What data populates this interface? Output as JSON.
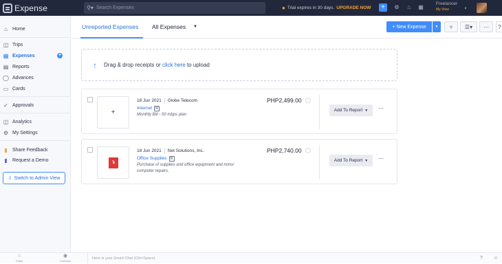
{
  "topbar": {
    "app_name": "Expense",
    "search_placeholder": "Search Expenses",
    "trial_text": "Trial expires in 30 days.",
    "upgrade_label": "UPGRADE NOW",
    "org_name": "Freelancer",
    "org_sub": "My View"
  },
  "sidebar": {
    "items": [
      {
        "label": "Home",
        "icon": "home-icon"
      },
      {
        "label": "Trips",
        "icon": "trips-icon"
      },
      {
        "label": "Expenses",
        "icon": "expenses-icon"
      },
      {
        "label": "Reports",
        "icon": "reports-icon"
      },
      {
        "label": "Advances",
        "icon": "advances-icon"
      },
      {
        "label": "Cards",
        "icon": "cards-icon"
      },
      {
        "label": "Approvals",
        "icon": "approvals-icon"
      },
      {
        "label": "Analytics",
        "icon": "analytics-icon"
      },
      {
        "label": "My Settings",
        "icon": "settings-icon"
      },
      {
        "label": "Share Feedback",
        "icon": "feedback-icon"
      },
      {
        "label": "Request a Demo",
        "icon": "demo-icon"
      }
    ],
    "admin_label": "Switch to Admin View"
  },
  "main": {
    "tab_unreported": "Unreported Expenses",
    "tab_all": "All Expenses",
    "new_expense_label": "New Expense",
    "dropzone": {
      "text_before": "Drag & drop receipts or ",
      "link": "click here",
      "text_after": " to upload"
    },
    "expenses": [
      {
        "date": "18 Jun 2021",
        "merchant": "Globe Telecom",
        "category": "Internet",
        "badge": "R",
        "description": "Monthly Bill - 50 mbps plan",
        "amount": "PHP2,499.00",
        "action": "Add To Report"
      },
      {
        "date": "18 Jun 2021",
        "merchant": "Net Solutions, Inc.",
        "category": "Office Supplies",
        "badge": "R",
        "description": "Purchase of supplies and office equipment and minor computer repairs.",
        "amount": "PHP2,740.00",
        "action": "Add To Report"
      }
    ]
  },
  "bottombar": {
    "chats_label": "Chats",
    "contacts_label": "Contacts",
    "smart_chat_placeholder": "Here is your Smart Chat (Ctrl+Space)"
  },
  "colors": {
    "topbar_bg": "#22283c",
    "accent": "#408dfb",
    "upgrade": "#f6a533"
  }
}
